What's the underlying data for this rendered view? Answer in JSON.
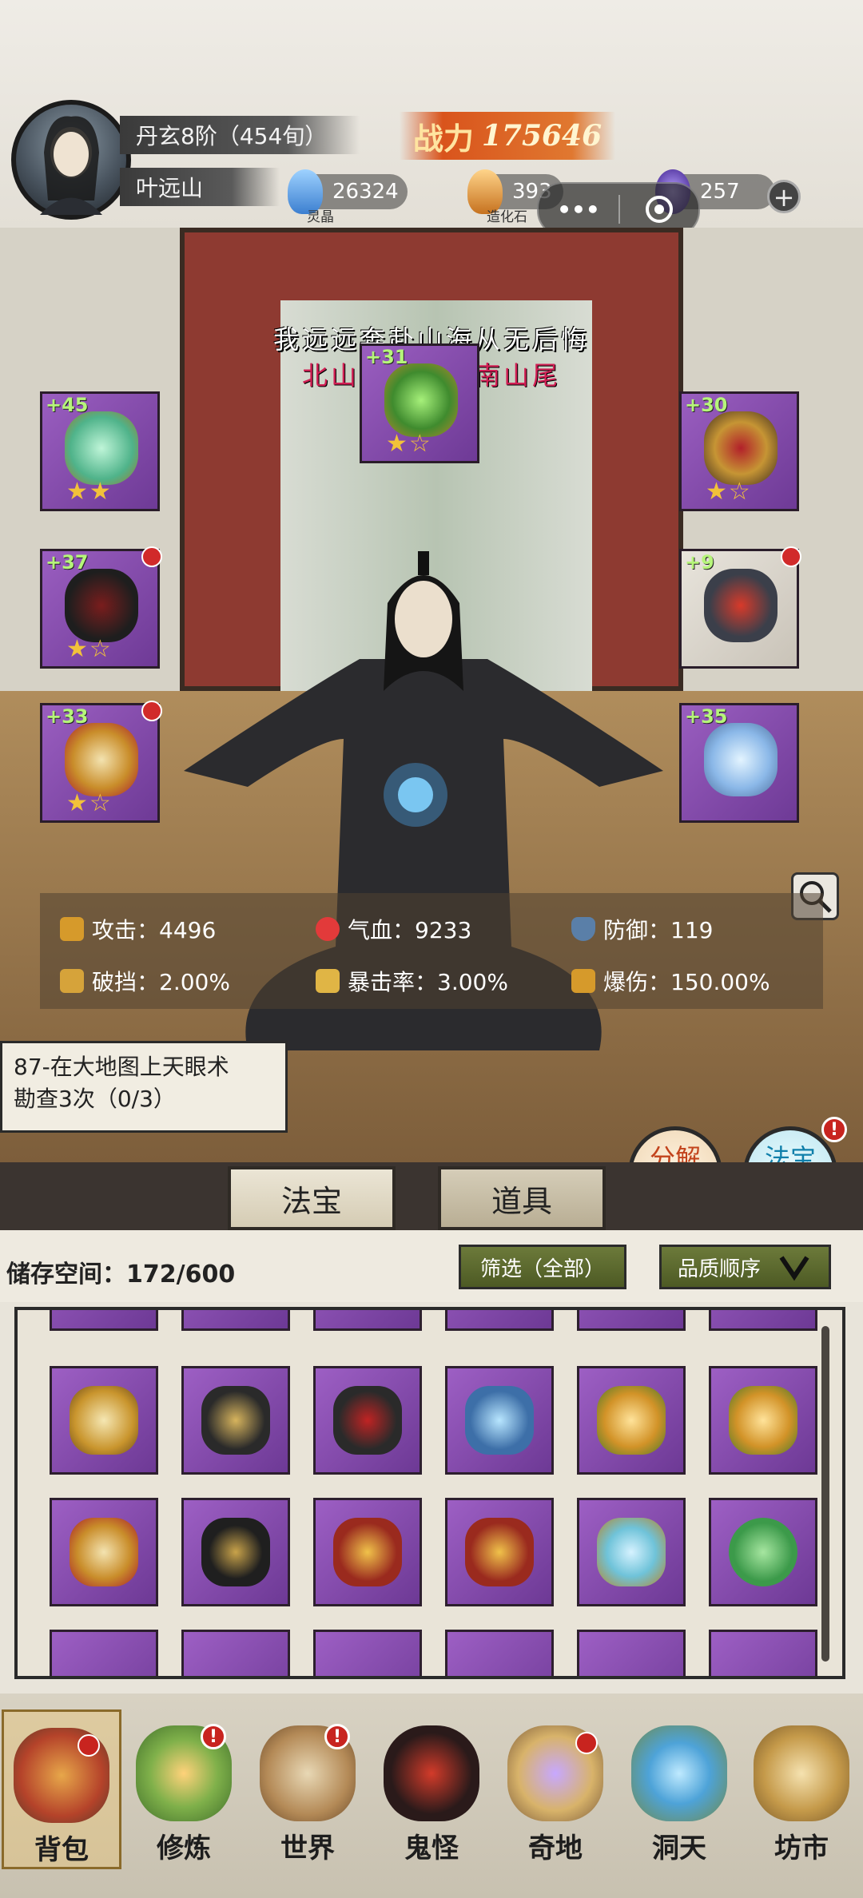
{
  "player": {
    "rank": "丹玄8阶（454旬）",
    "name": "叶远山",
    "power_label": "战力",
    "power_value": "175646"
  },
  "resources": [
    {
      "caption": "灵晶",
      "value": "26324",
      "icon": "blue-crystal-icon"
    },
    {
      "caption": "造化石",
      "value": "393",
      "icon": "orange-stone-icon"
    },
    {
      "caption": "",
      "value": "257",
      "icon": "purple-flame-icon"
    }
  ],
  "capsule": {
    "more": "•••"
  },
  "poem": {
    "line1": "我远远奔赴山海从无后悔",
    "line2": "北山风吹不到南山尾"
  },
  "equipment": [
    {
      "slot": "left-1",
      "level": "+45",
      "stars": "★★",
      "icon": "jade-mirror-icon",
      "has_dot": false
    },
    {
      "slot": "left-2",
      "level": "+37",
      "stars": "★☆",
      "icon": "dark-robe-icon",
      "has_dot": true
    },
    {
      "slot": "left-3",
      "level": "+33",
      "stars": "★☆",
      "icon": "golden-boot-icon",
      "has_dot": true
    },
    {
      "slot": "top-center",
      "level": "+31",
      "stars": "★☆",
      "icon": "green-crest-icon",
      "has_dot": false
    },
    {
      "slot": "right-1",
      "level": "+30",
      "stars": "★☆",
      "icon": "gold-crown-icon",
      "has_dot": false
    },
    {
      "slot": "right-2",
      "level": "+9",
      "stars": "",
      "icon": "beaded-pendant-icon",
      "has_dot": true
    },
    {
      "slot": "right-3",
      "level": "+35",
      "stars": "",
      "icon": "ice-ring-icon",
      "has_dot": false
    }
  ],
  "stats": {
    "attack": "攻击：4496",
    "hp": "气血：9233",
    "defense": "防御：119",
    "block_break": "破挡：2.00%",
    "crit_rate": "暴击率：3.00%",
    "crit_damage": "爆伤：150.00%"
  },
  "quest": {
    "line1": "87-在大地图上天眼术",
    "line2": "勘查3次（0/3）"
  },
  "side_buttons": {
    "dismantle": "分解\n再造",
    "synthesize": "法宝\n合成",
    "badge": "!"
  },
  "tabs": {
    "treasure": "法宝",
    "items": "道具"
  },
  "storage": {
    "label": "储存空间：172/600",
    "filter": "筛选（全部）",
    "sort": "品质顺序"
  },
  "grid": {
    "row1": [
      "golden-armor-icon",
      "dark-gauntlet-icon",
      "red-glove-icon",
      "ice-gauntlet-icon",
      "winged-boot-icon",
      "winged-boot-icon"
    ],
    "row2": [
      "golden-boot-icon",
      "black-staff-icon",
      "lion-head-icon",
      "lion-head-icon",
      "jade-ornament-icon",
      "leaf-wreath-icon"
    ]
  },
  "bottom_nav": [
    {
      "label": "背包",
      "icon": "bag-icon",
      "badge": "dot"
    },
    {
      "label": "修炼",
      "icon": "lotus-icon",
      "badge": "!"
    },
    {
      "label": "世界",
      "icon": "scroll-icon",
      "badge": "!"
    },
    {
      "label": "鬼怪",
      "icon": "egg-icon",
      "badge": ""
    },
    {
      "label": "奇地",
      "icon": "island-icon",
      "badge": "dot"
    },
    {
      "label": "洞天",
      "icon": "portal-icon",
      "badge": ""
    },
    {
      "label": "坊市",
      "icon": "market-icon",
      "badge": ""
    }
  ],
  "colors": {
    "purple_slot": "#8a4fb3",
    "level_green": "#b6f57a",
    "power_orange": "#d9541c",
    "badge_red": "#c8241f"
  }
}
